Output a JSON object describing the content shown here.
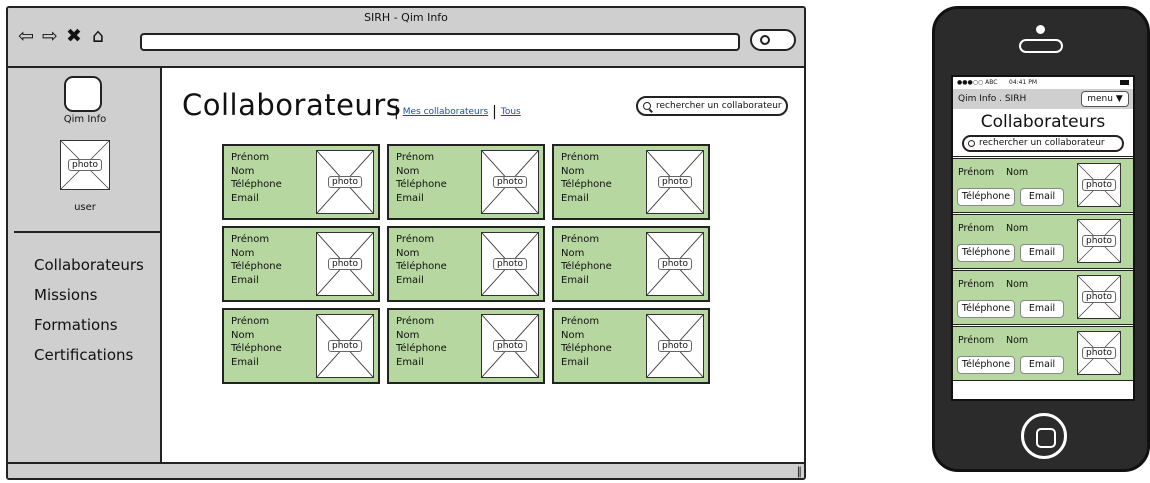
{
  "browser": {
    "title": "SIRH - Qim Info",
    "nav_icons": [
      "back-arrow-icon",
      "forward-arrow-icon",
      "close-icon",
      "home-icon"
    ]
  },
  "sidebar": {
    "logo_label": "Qim Info",
    "user_photo_label": "photo",
    "user_label": "user",
    "items": [
      {
        "label": "Collaborateurs"
      },
      {
        "label": "Missions"
      },
      {
        "label": "Formations"
      },
      {
        "label": "Certifications"
      }
    ]
  },
  "main": {
    "title": "Collaborateurs",
    "link_mine": "Mes collaborateurs",
    "link_all": "Tous",
    "search_placeholder": "rechercher un collaborateur",
    "card_fields": {
      "first_name": "Prénom",
      "last_name": "Nom",
      "phone": "Téléphone",
      "email": "Email",
      "photo": "photo"
    },
    "card_count": 9,
    "card_color": "#b7d7a0"
  },
  "mobile": {
    "status_carrier": "●●●○○ ABC",
    "status_time": "04:41 PM",
    "header_label": "Qim Info . SIRH",
    "menu_label": "menu ▼",
    "title": "Collaborateurs",
    "search_placeholder": "rechercher un collaborateur",
    "card_fields": {
      "first_name": "Prénom",
      "last_name": "Nom",
      "phone_button": "Téléphone",
      "email_button": "Email",
      "photo": "photo"
    },
    "card_count": 4
  }
}
